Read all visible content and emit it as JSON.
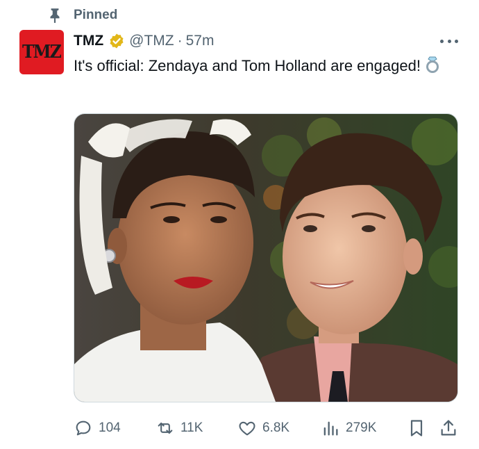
{
  "pinned": {
    "label": "Pinned",
    "icon": "pin-icon"
  },
  "tweet": {
    "author": {
      "name": "TMZ",
      "handle": "@TMZ",
      "verified": true,
      "avatar_text": "TMZ",
      "avatar_color": "#e01b22"
    },
    "separator": "·",
    "time": "57m",
    "text": "It's official: Zendaya and Tom Holland are engaged!",
    "emoji": "ring-icon",
    "media": {
      "type": "photo"
    }
  },
  "actions": {
    "reply": {
      "icon": "reply-icon",
      "count": "104"
    },
    "retweet": {
      "icon": "retweet-icon",
      "count": "11K"
    },
    "like": {
      "icon": "heart-icon",
      "count": "6.8K"
    },
    "views": {
      "icon": "views-icon",
      "count": "279K"
    },
    "bookmark": {
      "icon": "bookmark-icon"
    },
    "share": {
      "icon": "share-icon"
    }
  },
  "colors": {
    "text": "#0f1419",
    "muted": "#536471",
    "verified_gold": "#e2b719",
    "border": "#cfd9de"
  }
}
